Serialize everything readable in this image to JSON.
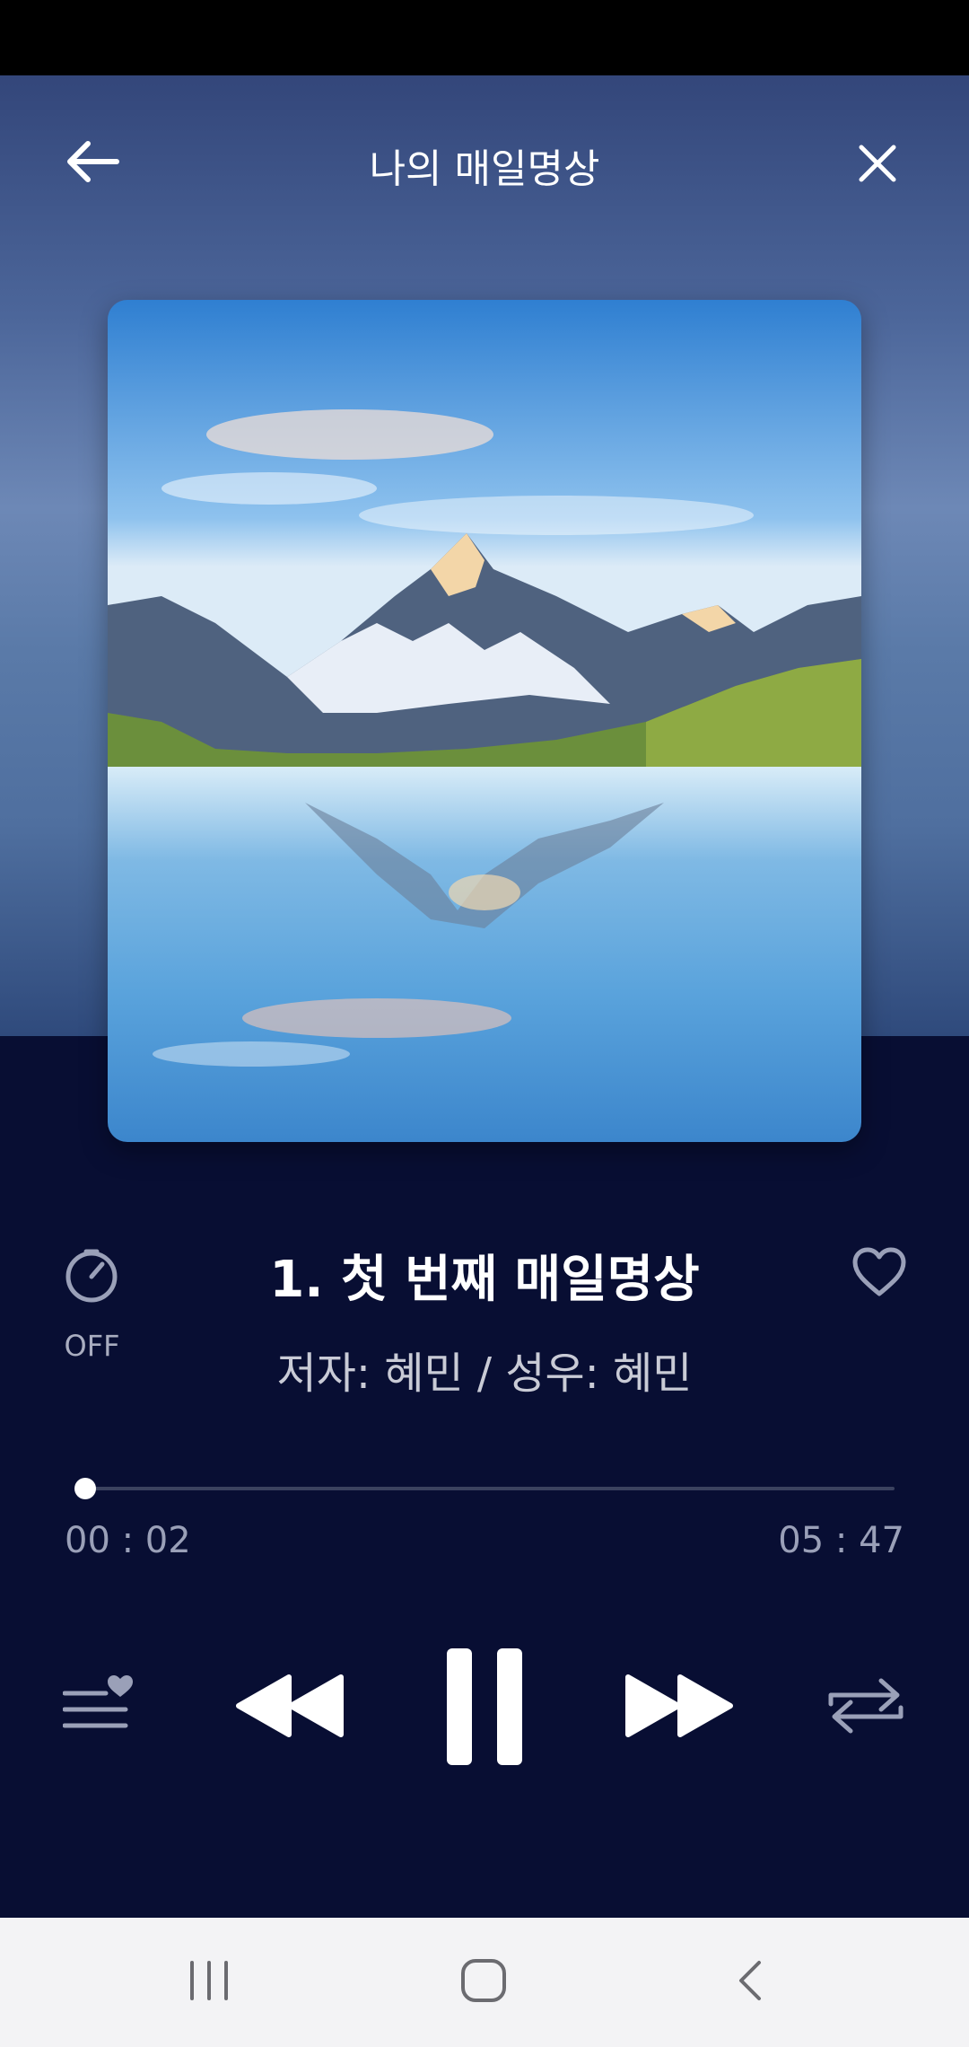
{
  "header": {
    "title": "나의 매일명상"
  },
  "track": {
    "title": "1. 첫 번째 매일명상",
    "subtitle": "저자: 혜민 / 성우: 혜민",
    "favorite": false
  },
  "timer": {
    "label": "OFF"
  },
  "progress": {
    "current": "00 : 02",
    "total": "05 : 47",
    "fraction": 0.006
  },
  "controls": {
    "playlist": "playlist-heart-icon",
    "rewind": "rewind-icon",
    "pause": "pause-icon",
    "forward": "fast-forward-icon",
    "repeat": "repeat-icon"
  },
  "colors": {
    "panel_bg": "#080e33",
    "accent": "#ffffff",
    "muted": "#9aa0b8"
  }
}
